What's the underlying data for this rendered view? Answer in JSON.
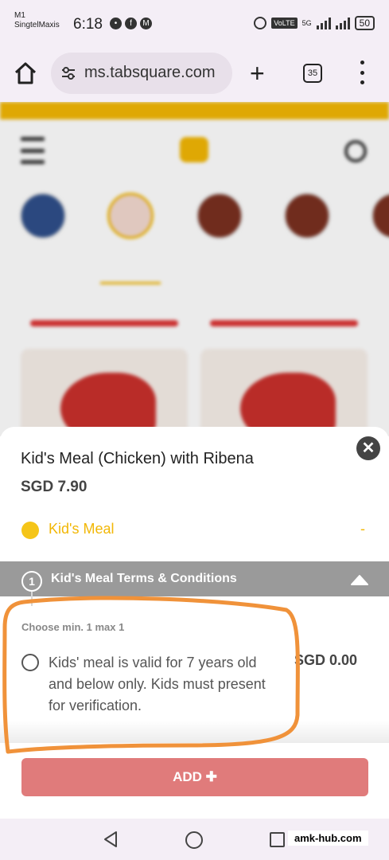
{
  "status_bar": {
    "carrier_line1": "M1",
    "carrier_line2": "SingtelMaxis",
    "time": "6:18",
    "volte": "VoLTE",
    "network": "5G",
    "battery": "50"
  },
  "browser": {
    "url": "ms.tabsquare.com",
    "tab_count": "35"
  },
  "item": {
    "title": "Kid's Meal (Chicken) with Ribena",
    "price": "SGD 7.90"
  },
  "selected_option": {
    "label": "Kid's Meal",
    "value": "-"
  },
  "section": {
    "step": "1",
    "title": "Kid's Meal Terms & Conditions",
    "hint": "Choose min. 1 max 1",
    "choices": [
      {
        "label": "Kids' meal is valid for 7 years old and below only. Kids must present for verification.",
        "price": "SGD 0.00"
      }
    ]
  },
  "add_button": {
    "label": "ADD ✚"
  },
  "watermark": "amk-hub.com",
  "colors": {
    "brand_yellow": "#f2b705",
    "add_button": "#e07b7b",
    "section_header": "#9a9a9a",
    "annotation": "#f0923a"
  }
}
